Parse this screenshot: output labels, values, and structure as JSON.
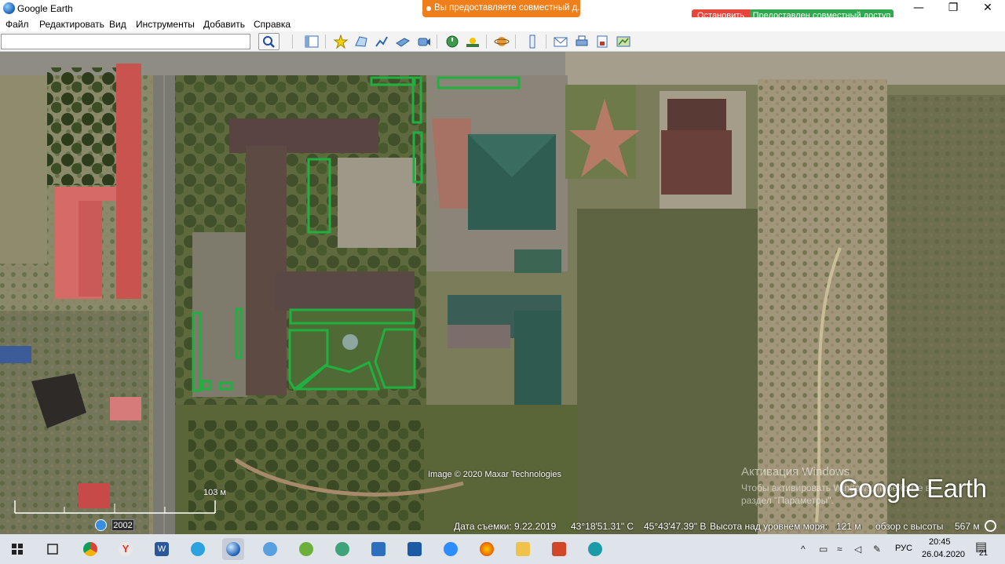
{
  "titlebar": {
    "app_title": "Google Earth",
    "share_banner": "Вы предоставляете совместный д...",
    "stop_label": "Остановить",
    "shared_label": "Предоставлен совместный доступ",
    "minimize": "—",
    "maximize": "❐",
    "close": "✕"
  },
  "menu": {
    "file": "Файл",
    "edit": "Редактировать",
    "view": "Вид",
    "tools": "Инструменты",
    "add": "Добавить",
    "help": "Справка"
  },
  "toolbar": {
    "search_value": "",
    "icons": [
      "sidebar-toggle-icon",
      "placemark-icon",
      "polygon-icon",
      "path-icon",
      "image-overlay-icon",
      "record-tour-icon",
      "historical-imagery-icon",
      "sunlight-icon",
      "planets-icon",
      "ruler-icon",
      "email-icon",
      "print-icon",
      "save-image-icon",
      "view-in-maps-icon"
    ]
  },
  "map": {
    "image_credit": "Image © 2020 Maxar Technologies",
    "activation_title": "Активация Windows",
    "activation_text": "Чтобы активировать Windows, перейдите в раздел \"Параметры\".",
    "logo": "Google Earth",
    "scale_label": "103 м",
    "year": "2002"
  },
  "status": {
    "capture_date": "Дата съемки: 9.22.2019",
    "latitude": "43°18'51.31\" С",
    "longitude": "45°43'47.39\" В",
    "elevation_label": "Высота над уровнем моря:",
    "elevation_value": "121 м",
    "eye_alt_label": "обзор с высоты",
    "eye_alt_value": "567 м"
  },
  "taskbar": {
    "apps": [
      "start",
      "task-view",
      "chrome",
      "yandex",
      "word",
      "telegram",
      "google-earth",
      "magnifier",
      "skype",
      "ie",
      "files",
      "video",
      "zoom",
      "firefox",
      "explorer",
      "powerpoint",
      "other"
    ],
    "lang": "РУС",
    "time": "20:45",
    "date": "26.04.2020",
    "notifications": "21"
  },
  "colors": {
    "banner": "#ef7f1a",
    "stop": "#e8453c",
    "shared": "#2fa84f",
    "outline": "#20b040"
  }
}
